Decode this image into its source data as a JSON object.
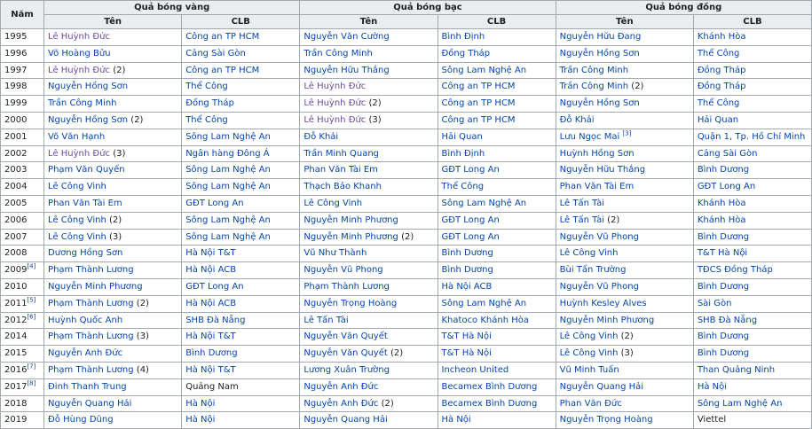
{
  "headers": {
    "year": "Năm",
    "gold": "Quả bóng vàng",
    "silver": "Quả bóng bạc",
    "bronze": "Quả bóng đồng",
    "name": "Tên",
    "club": "CLB"
  },
  "rows": [
    {
      "year": "1995",
      "gold": {
        "name": "Lê Huỳnh Đức",
        "club": "Công an TP HCM"
      },
      "silver": {
        "name": "Nguyễn Văn Cường",
        "club": "Bình Định"
      },
      "bronze": {
        "name": "Nguyễn Hữu Đang",
        "club": "Khánh Hòa"
      }
    },
    {
      "year": "1996",
      "gold": {
        "name": "Võ Hoàng Bửu",
        "club": "Cảng Sài Gòn"
      },
      "silver": {
        "name": "Trần Công Minh",
        "club": "Đồng Tháp"
      },
      "bronze": {
        "name": "Nguyễn Hồng Sơn",
        "club": "Thể Công"
      }
    },
    {
      "year": "1997",
      "gold": {
        "name": "Lê Huỳnh Đức",
        "count": "(2)",
        "club": "Công an TP HCM"
      },
      "silver": {
        "name": "Nguyễn Hữu Thắng",
        "club": "Sông Lam Nghệ An"
      },
      "bronze": {
        "name": "Trần Công Minh",
        "club": "Đồng Tháp"
      }
    },
    {
      "year": "1998",
      "gold": {
        "name": "Nguyễn Hồng Sơn",
        "club": "Thể Công"
      },
      "silver": {
        "name": "Lê Huỳnh Đức",
        "club": "Công an TP HCM"
      },
      "bronze": {
        "name": "Trần Công Minh",
        "count": "(2)",
        "club": "Đồng Tháp"
      }
    },
    {
      "year": "1999",
      "gold": {
        "name": "Trần Công Minh",
        "club": "Đồng Tháp"
      },
      "silver": {
        "name": "Lê Huỳnh Đức",
        "count": "(2)",
        "club": "Công an TP HCM"
      },
      "bronze": {
        "name": "Nguyễn Hồng Sơn",
        "club": "Thể Công"
      }
    },
    {
      "year": "2000",
      "gold": {
        "name": "Nguyễn Hồng Sơn",
        "count": "(2)",
        "club": "Thể Công"
      },
      "silver": {
        "name": "Lê Huỳnh Đức",
        "count": "(3)",
        "club": "Công an TP HCM"
      },
      "bronze": {
        "name": "Đỗ Khải",
        "club": "Hải Quan"
      }
    },
    {
      "year": "2001",
      "gold": {
        "name": "Võ Văn Hạnh",
        "club": "Sông Lam Nghệ An"
      },
      "silver": {
        "name": "Đỗ Khải",
        "club": "Hải Quan"
      },
      "bronze": {
        "name": "Lưu Ngọc Mai",
        "ref": "[3]",
        "club": "Quận 1, Tp. Hồ Chí Minh"
      }
    },
    {
      "year": "2002",
      "gold": {
        "name": "Lê Huỳnh Đức",
        "count": "(3)",
        "club": "Ngân hàng Đông Á"
      },
      "silver": {
        "name": "Trần Minh Quang",
        "club": "Bình Định"
      },
      "bronze": {
        "name": "Huỳnh Hồng Sơn",
        "club": "Cảng Sài Gòn"
      }
    },
    {
      "year": "2003",
      "gold": {
        "name": "Phạm Văn Quyến",
        "club": "Sông Lam Nghệ An"
      },
      "silver": {
        "name": "Phan Văn Tài Em",
        "club": "GĐT Long An"
      },
      "bronze": {
        "name": "Nguyễn Hữu Thắng",
        "club": "Bình Dương"
      }
    },
    {
      "year": "2004",
      "gold": {
        "name": "Lê Công Vinh",
        "club": "Sông Lam Nghệ An"
      },
      "silver": {
        "name": "Thạch Bảo Khanh",
        "club": "Thể Công"
      },
      "bronze": {
        "name": "Phan Văn Tài Em",
        "club": "GĐT Long An"
      }
    },
    {
      "year": "2005",
      "gold": {
        "name": "Phan Văn Tài Em",
        "club": "GĐT Long An"
      },
      "silver": {
        "name": "Lê Công Vinh",
        "club": "Sông Lam Nghệ An"
      },
      "bronze": {
        "name": "Lê Tấn Tài",
        "club": "Khánh Hòa"
      }
    },
    {
      "year": "2006",
      "gold": {
        "name": "Lê Công Vinh",
        "count": "(2)",
        "club": "Sông Lam Nghệ An"
      },
      "silver": {
        "name": "Nguyễn Minh Phương",
        "club": "GĐT Long An"
      },
      "bronze": {
        "name": "Lê Tấn Tài",
        "count": "(2)",
        "club": "Khánh Hòa"
      }
    },
    {
      "year": "2007",
      "gold": {
        "name": "Lê Công Vinh",
        "count": "(3)",
        "club": "Sông Lam Nghệ An"
      },
      "silver": {
        "name": "Nguyễn Minh Phương",
        "count": "(2)",
        "club": "GĐT Long An"
      },
      "bronze": {
        "name": "Nguyễn Vũ Phong",
        "club": "Bình Dương"
      }
    },
    {
      "year": "2008",
      "gold": {
        "name": "Dương Hồng Sơn",
        "club": "Hà Nội T&T"
      },
      "silver": {
        "name": "Vũ Như Thành",
        "club": "Bình Dương"
      },
      "bronze": {
        "name": "Lê Công Vinh",
        "club": "T&T Hà Nội"
      }
    },
    {
      "year": "2009",
      "ref": "[4]",
      "gold": {
        "name": "Phạm Thành Lương",
        "club": "Hà Nội ACB"
      },
      "silver": {
        "name": "Nguyễn Vũ Phong",
        "club": "Bình Dương"
      },
      "bronze": {
        "name": "Bùi Tấn Trường",
        "club": "TĐCS Đồng Tháp"
      }
    },
    {
      "year": "2010",
      "gold": {
        "name": "Nguyễn Minh Phương",
        "club": "GĐT Long An"
      },
      "silver": {
        "name": "Phạm Thành Lương",
        "club": "Hà Nội ACB"
      },
      "bronze": {
        "name": "Nguyễn Vũ Phong",
        "club": "Bình Dương"
      }
    },
    {
      "year": "2011",
      "ref": "[5]",
      "gold": {
        "name": "Phạm Thành Lương",
        "count": "(2)",
        "club": "Hà Nội ACB"
      },
      "silver": {
        "name": "Nguyễn Trọng Hoàng",
        "club": "Sông Lam Nghệ An"
      },
      "bronze": {
        "name": "Huỳnh Kesley Alves",
        "club": "Sài Gòn"
      }
    },
    {
      "year": "2012",
      "ref": "[6]",
      "gold": {
        "name": "Huỳnh Quốc Anh",
        "club": "SHB Đà Nẵng"
      },
      "silver": {
        "name": "Lê Tấn Tài",
        "club": "Khatoco Khánh Hòa"
      },
      "bronze": {
        "name": "Nguyễn Minh Phương",
        "club": "SHB Đà Nẵng"
      }
    },
    {
      "year": "2014",
      "gold": {
        "name": "Phạm Thành Lương",
        "count": "(3)",
        "club": "Hà Nội T&T"
      },
      "silver": {
        "name": "Nguyễn Văn Quyết",
        "club": "T&T Hà Nội"
      },
      "bronze": {
        "name": "Lê Công Vinh",
        "count": "(2)",
        "club": "Bình Dương"
      }
    },
    {
      "year": "2015",
      "gold": {
        "name": "Nguyễn Anh Đức",
        "club": "Bình Dương"
      },
      "silver": {
        "name": "Nguyễn Văn Quyết",
        "count": "(2)",
        "club": "T&T Hà Nội"
      },
      "bronze": {
        "name": "Lê Công Vinh",
        "count": "(3)",
        "club": "Bình Dương"
      }
    },
    {
      "year": "2016",
      "ref": "[7]",
      "gold": {
        "name": "Phạm Thành Lương",
        "count": "(4)",
        "club": "Hà Nội T&T"
      },
      "silver": {
        "name": "Lương Xuân Trường",
        "club": "Incheon United"
      },
      "bronze": {
        "name": "Vũ Minh Tuấn",
        "club": "Than Quảng Ninh"
      }
    },
    {
      "year": "2017",
      "ref": "[8]",
      "gold": {
        "name": "Đinh Thanh Trung",
        "club": "Quảng Nam"
      },
      "silver": {
        "name": "Nguyễn Anh Đức",
        "club": "Becamex Bình Dương"
      },
      "bronze": {
        "name": "Nguyễn Quang Hải",
        "club": "Hà Nội"
      }
    },
    {
      "year": "2018",
      "gold": {
        "name": "Nguyễn Quang Hải",
        "club": "Hà Nội"
      },
      "silver": {
        "name": "Nguyễn Anh Đức",
        "count": "(2)",
        "club": "Becamex Bình Dương"
      },
      "bronze": {
        "name": "Phan Văn Đức",
        "club": "Sông Lam Nghệ An"
      }
    },
    {
      "year": "2019",
      "gold": {
        "name": "Đỗ Hùng Dũng",
        "club": "Hà Nội"
      },
      "silver": {
        "name": "Nguyễn Quang Hải",
        "club": "Hà Nội"
      },
      "bronze": {
        "name": "Nguyễn Trọng Hoàng",
        "club": "Viettel"
      }
    }
  ],
  "colors": {
    "link": "#0645ad",
    "visited": "#6b4ba1",
    "border": "#a2a9b1",
    "header_bg": "#eaecf0"
  }
}
